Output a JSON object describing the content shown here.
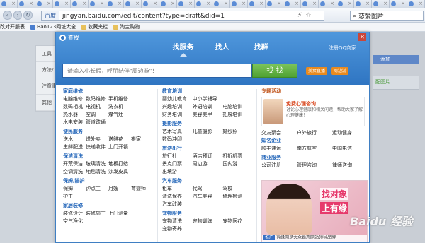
{
  "browser": {
    "site_badge": "百度",
    "url": "jingyan.baidu.com/edit/content?type=draft&did=1",
    "tools": [
      "⚡",
      "☆"
    ],
    "search_text": "恋爱图片",
    "tab_count": 24
  },
  "bookmarks": [
    {
      "label": "改对开服表",
      "icon": "orange"
    },
    {
      "label": "Hao123网址大全",
      "icon": "blue"
    },
    {
      "label": "收藏夹栏",
      "icon": "folder"
    },
    {
      "label": "淘宝购物",
      "icon": "folder"
    }
  ],
  "background": {
    "menu": [
      "工具",
      "方法/",
      "注意事",
      "其他"
    ],
    "right_button": "＋添加",
    "right_green": "配图片"
  },
  "modal": {
    "title": "查找",
    "close": "✕",
    "tabs": [
      "找服务",
      "找人",
      "找群"
    ],
    "register": "注册QQ商家",
    "search_placeholder": "请输入小长假，呼朋结伴\"周边游\"！",
    "search_button": "找 找",
    "pills": [
      "美女直播",
      "周边游"
    ]
  },
  "col1": [
    {
      "title": "家庭维修",
      "items": [
        "电脑维修",
        "数码维修",
        "手机维修",
        "",
        "数码相机",
        "电视机",
        "洗衣机",
        "",
        "热水器",
        "空调",
        "煤气灶",
        "",
        "水电安装",
        "管道疏通",
        "",
        ""
      ]
    },
    {
      "title": "便民服务",
      "items": [
        "送水",
        "送外卖",
        "送鲜花",
        "搬家",
        "生鲜配送",
        "快递收件",
        "上门开锁",
        ""
      ]
    },
    {
      "title": "保洁清洗",
      "items": [
        "开荒保洁",
        "玻璃清洗",
        "地板打蜡",
        "",
        "空调清洗",
        "地毯清洗",
        "沙发皮具",
        ""
      ]
    },
    {
      "title": "保姆/陪护",
      "items": [
        "保姆",
        "钟点工",
        "月嫂",
        "育婴师",
        "护工",
        "",
        "",
        ""
      ]
    },
    {
      "title": "家居装修",
      "items": [
        "装修设计",
        "装修施工",
        "上门测量",
        "",
        "空气净化",
        "",
        "",
        ""
      ]
    }
  ],
  "col2": [
    {
      "title": "教育培训",
      "items": [
        "婴幼儿教育",
        "中小学辅导",
        "",
        "兴趣培训",
        "外语培训",
        "电脑培训",
        "财务培训",
        "美容美甲",
        "拓展培训"
      ]
    },
    {
      "title": "摄影服务",
      "items": [
        "艺术写真",
        "儿童摄影",
        "婚纱照",
        "数码冲印",
        "",
        ""
      ]
    },
    {
      "title": "旅游出行",
      "items": [
        "旅行社",
        "酒店预订",
        "打折机票",
        "景点门票",
        "周边游",
        "国内游",
        "出境游",
        "",
        ""
      ]
    },
    {
      "title": "汽车服务",
      "items": [
        "租车",
        "代驾",
        "驾校",
        "清洗保养",
        "汽车美容",
        "修理检测",
        "汽车改装",
        "",
        ""
      ]
    },
    {
      "title": "宠物服务",
      "items": [
        "宠物清洗",
        "宠物训练",
        "宠物医疗",
        "宠物寄养",
        "",
        ""
      ]
    }
  ],
  "col3": {
    "special_title": "专题活动",
    "promo_title": "免费心理咨询",
    "promo_text": "讨论心理健康和相关问题，帮助大家了解心理健康！",
    "promo_items": [
      "交友聚会",
      "户外旅行",
      "运动健身"
    ],
    "cats": [
      {
        "title": "知名企业",
        "items": [
          "顺丰速运",
          "南方航空",
          "中国电信"
        ]
      },
      {
        "title": "商业服务",
        "items": [
          "公司注册",
          "管理咨询",
          "律师咨询"
        ]
      }
    ]
  },
  "ad": {
    "headline1": "找对象",
    "headline2": "上有缘",
    "tag": "推广",
    "caption": "有缘网是大众婚恋网站领导品牌"
  },
  "watermark": "Baidu 经验"
}
